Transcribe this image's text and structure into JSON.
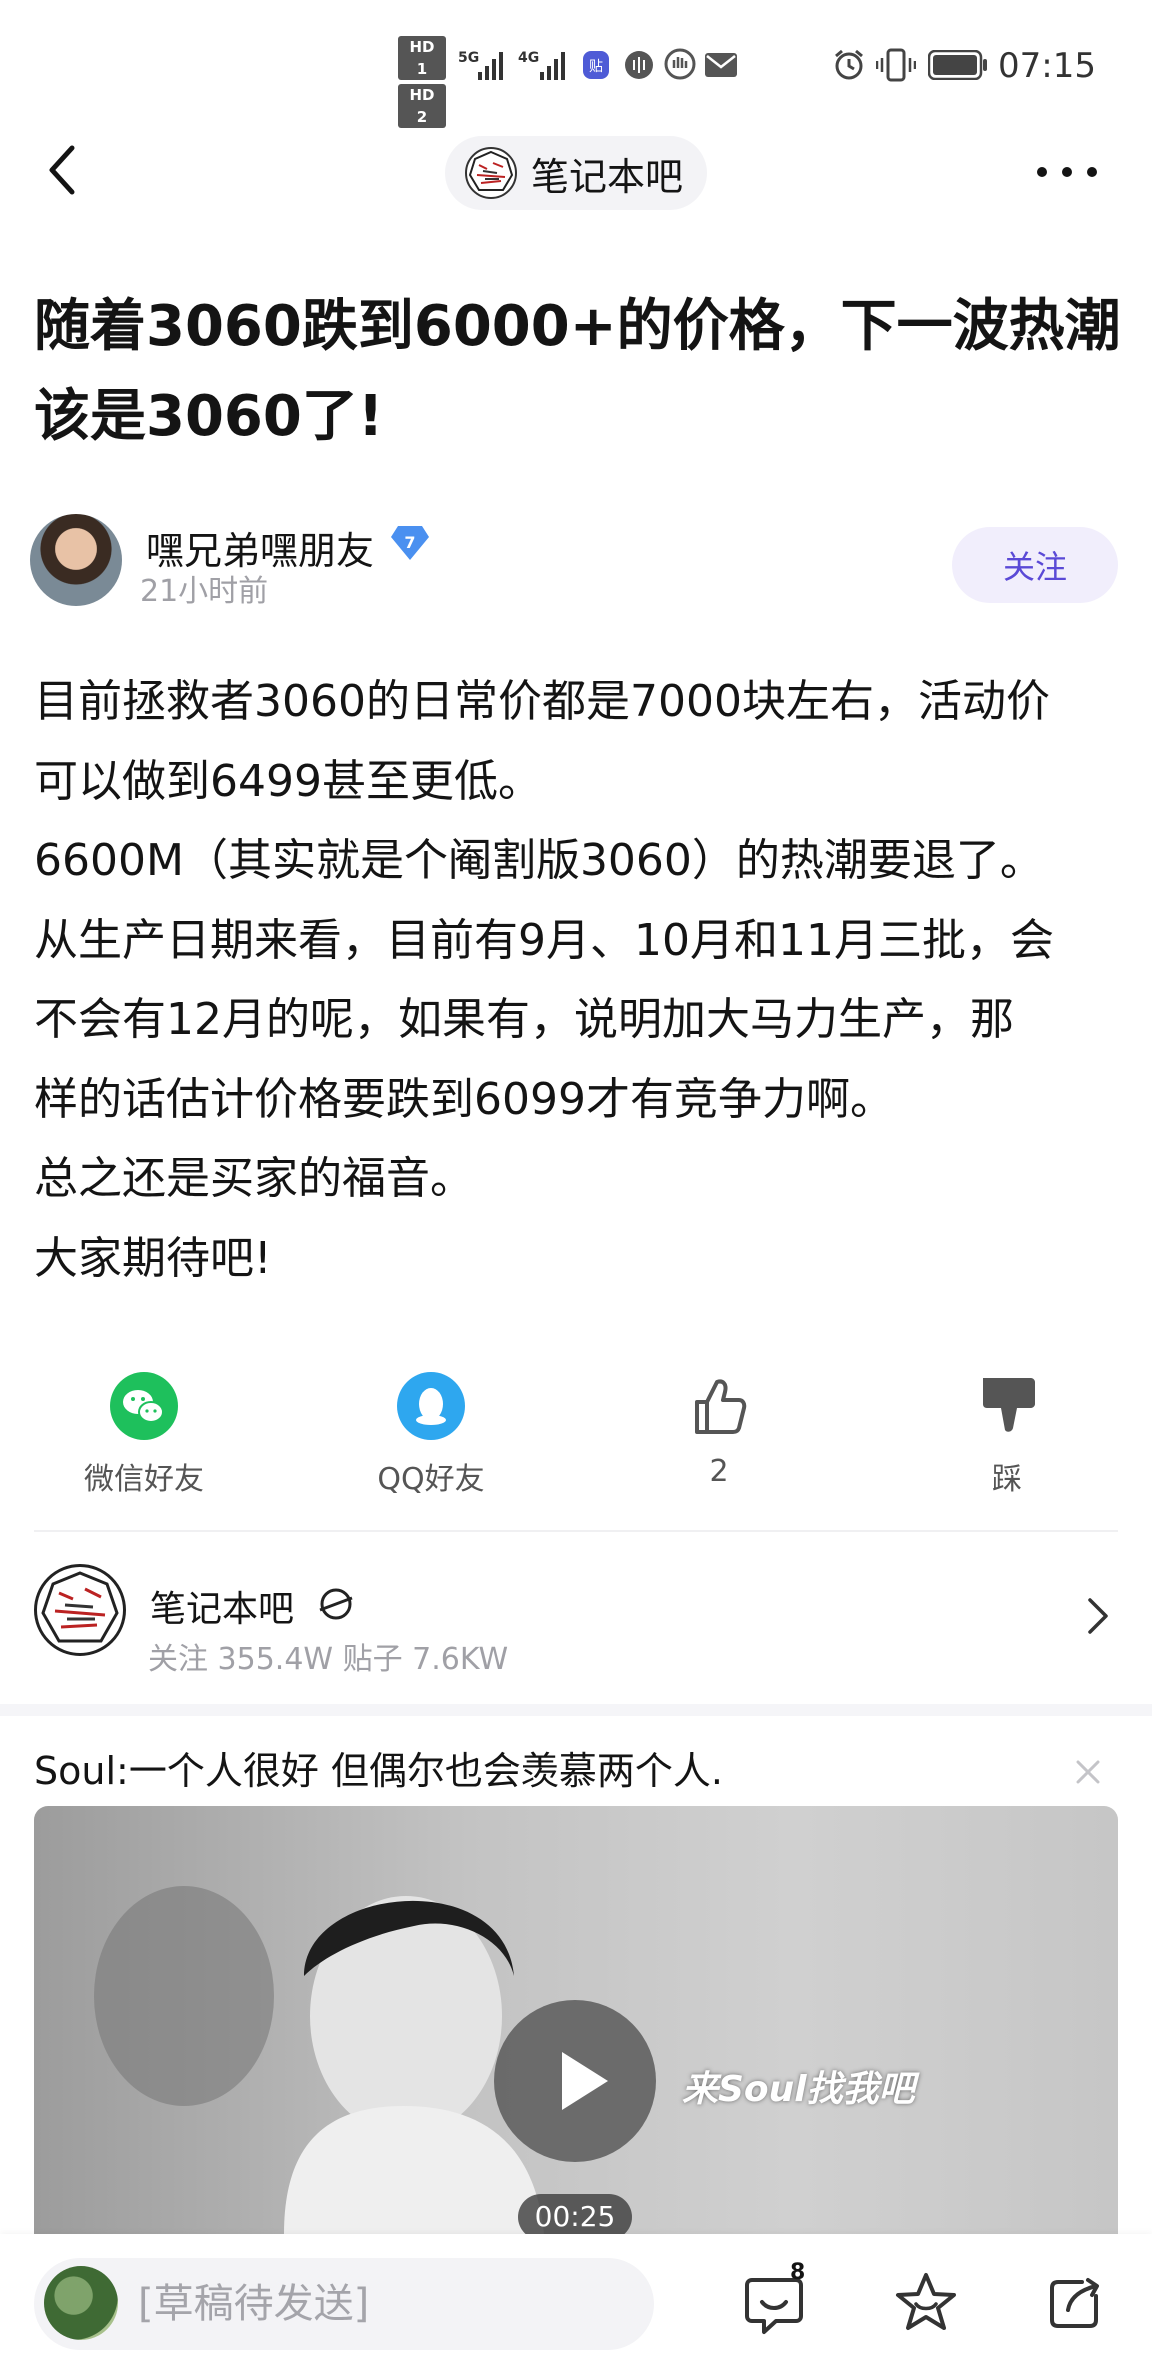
{
  "status_bar": {
    "hd1": "HD 1",
    "hd2": "HD 2",
    "net1": "5G",
    "net2": "4G",
    "time": "07:15"
  },
  "header": {
    "forum_name": "笔记本吧"
  },
  "post": {
    "title": "随着3060跌到6000+的价格，下一波热潮该是3060了!",
    "author": "嘿兄弟嘿朋友",
    "level": "7",
    "time_ago": "21小时前",
    "follow_label": "关注",
    "body": [
      "目前拯救者3060的日常价都是7000块左右，活动价",
      "可以做到6499甚至更低。",
      "6600M（其实就是个阉割版3060）的热潮要退了。",
      "从生产日期来看，目前有9月、10月和11月三批，会",
      "不会有12月的呢，如果有，说明加大马力生产，那",
      "样的话估计价格要跌到6099才有竞争力啊。",
      "总之还是买家的福音。",
      "大家期待吧!"
    ]
  },
  "actions": {
    "wechat": "微信好友",
    "qq": "QQ好友",
    "like_count": "2",
    "dislike": "踩"
  },
  "forum_card": {
    "name": "笔记本吧",
    "stats": "关注 355.4W   贴子 7.6KW"
  },
  "ad": {
    "title": "Soul:一个人很好 但偶尔也会羡慕两个人.",
    "caption": "来Soul找我吧",
    "duration": "00:25"
  },
  "bottom_bar": {
    "draft_placeholder": "[草稿待发送]",
    "reply_count": "8"
  },
  "colors": {
    "accent": "#5a49d6",
    "wechat": "#1ec05c",
    "qq": "#2ea7ef",
    "level_badge": "#4a90f0"
  }
}
